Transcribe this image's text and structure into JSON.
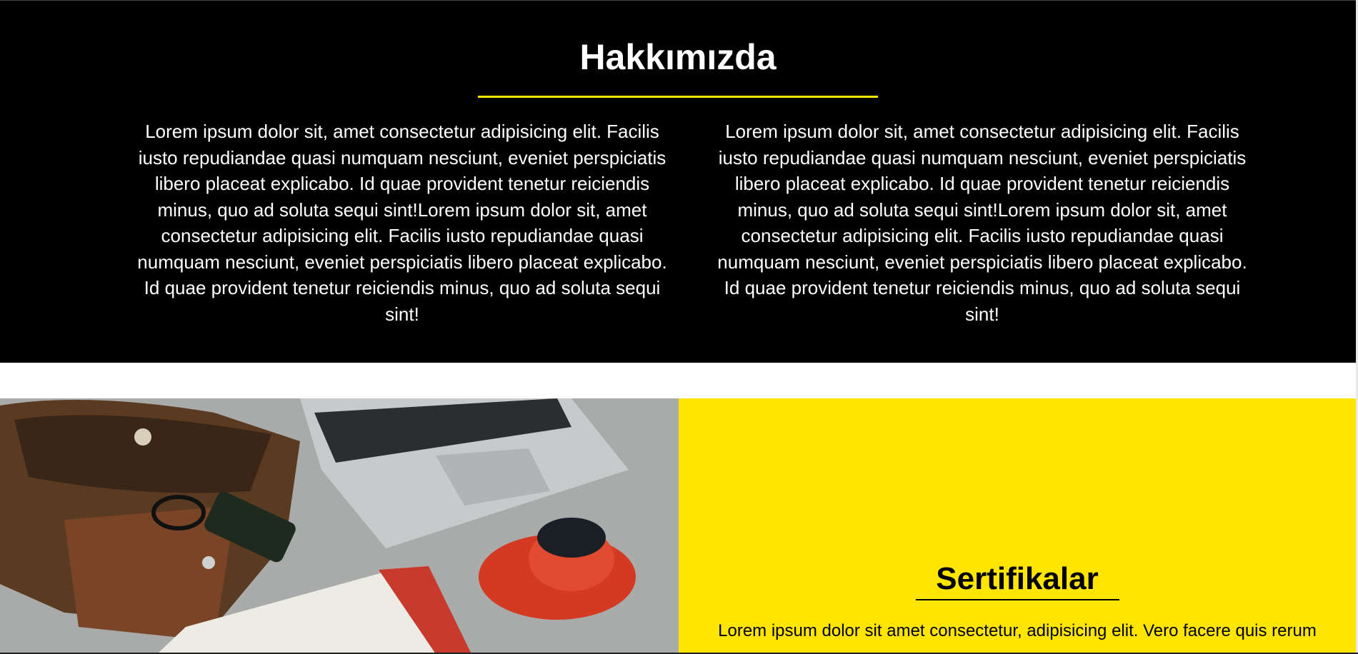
{
  "about": {
    "title": "Hakkımızda",
    "col1": "Lorem ipsum dolor sit, amet consectetur adipisicing elit. Facilis iusto repudiandae quasi numquam nesciunt, eveniet perspiciatis libero placeat explicabo. Id quae provident tenetur reiciendis minus, quo ad soluta sequi sint!Lorem ipsum dolor sit, amet consectetur adipisicing elit. Facilis iusto repudiandae quasi numquam nesciunt, eveniet perspiciatis libero placeat explicabo. Id quae provident tenetur reiciendis minus, quo ad soluta sequi sint!",
    "col2": "Lorem ipsum dolor sit, amet consectetur adipisicing elit. Facilis iusto repudiandae quasi numquam nesciunt, eveniet perspiciatis libero placeat explicabo. Id quae provident tenetur reiciendis minus, quo ad soluta sequi sint!Lorem ipsum dolor sit, amet consectetur adipisicing elit. Facilis iusto repudiandae quasi numquam nesciunt, eveniet perspiciatis libero placeat explicabo. Id quae provident tenetur reiciendis minus, quo ad soluta sequi sint!"
  },
  "certificates": {
    "title": "Sertifikalar",
    "text": "Lorem ipsum dolor sit amet consectetur, adipisicing elit. Vero facere quis rerum"
  },
  "colors": {
    "accent": "#ffe500",
    "dark": "#000000"
  }
}
